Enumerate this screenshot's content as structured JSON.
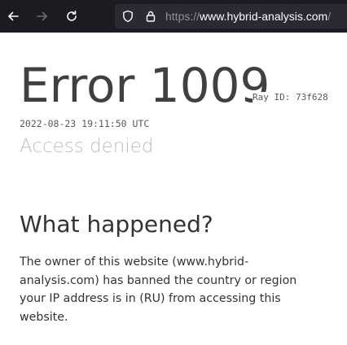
{
  "browser": {
    "back_icon": "arrow-left-icon",
    "forward_icon": "arrow-right-icon",
    "reload_icon": "reload-icon",
    "shield_icon": "tracking-protection-shield-icon",
    "lock_icon": "lock-icon",
    "url": {
      "protocol": "https://",
      "host": "www.hybrid-analysis.com",
      "rest": "/"
    },
    "colors": {
      "toolbar": "#1c1b22",
      "urlbar": "#2b2a33",
      "icon": "#fbfbfe",
      "icon_disabled": "#6f6e76"
    }
  },
  "page": {
    "error_title": "Error 1009",
    "ray_id": "Ray ID: 73f628",
    "timestamp": "2022-08-23 19:11:50 UTC",
    "status": "Access denied",
    "what_happened_heading": "What happened?",
    "explanation": "The owner of this website (www.hybrid-analysis.com) has banned the country or region your IP address is in (RU) from accessing this website."
  }
}
